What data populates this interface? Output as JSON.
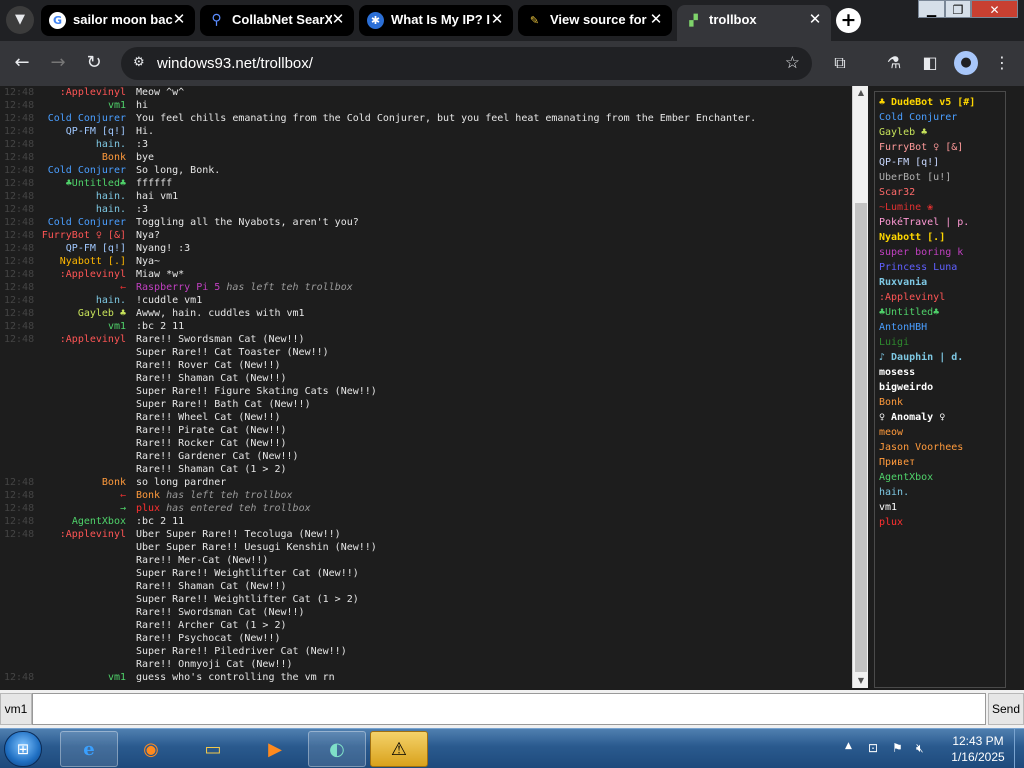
{
  "browser": {
    "tabs": [
      {
        "title": "sailor moon bac",
        "icon": "google-g",
        "active": false
      },
      {
        "title": "CollabNet SearX",
        "icon": "magnifier",
        "active": false
      },
      {
        "title": "What Is My IP? I",
        "icon": "ip-globe",
        "active": false
      },
      {
        "title": "View source for",
        "icon": "wiki",
        "active": false
      },
      {
        "title": "trollbox",
        "icon": "windows93",
        "active": true
      }
    ],
    "url": "windows93.net/trollbox/"
  },
  "chat": {
    "messages": [
      {
        "time": "12:48",
        "nick": ":Applevinyl",
        "nick_color": "#ff5555",
        "text": "Meow ^w^",
        "type": "msg"
      },
      {
        "time": "12:48",
        "nick": "vm1",
        "nick_color": "#4fd26a",
        "text": "hi",
        "type": "msg"
      },
      {
        "time": "12:48",
        "nick": "Cold Conjurer",
        "nick_color": "#4a9eff",
        "text": "You feel chills emanating from the Cold Conjurer, but you feel heat emanating from the Ember Enchanter.",
        "type": "msg"
      },
      {
        "time": "12:48",
        "nick": "QP-FM [q!]",
        "nick_color": "#a0c8ff",
        "text": "Hi.",
        "type": "msg"
      },
      {
        "time": "12:48",
        "nick": "hain.",
        "nick_color": "#7ec8e3",
        "text": ":3",
        "type": "msg"
      },
      {
        "time": "12:48",
        "nick": "Bonk",
        "nick_color": "#ff9a3c",
        "text": "bye",
        "type": "msg"
      },
      {
        "time": "12:48",
        "nick": "Cold Conjurer",
        "nick_color": "#4a9eff",
        "text": "So long, Bonk.",
        "type": "msg"
      },
      {
        "time": "12:48",
        "nick": "♣Untitled♣",
        "nick_color": "#4fd26a",
        "text": "ffffff",
        "type": "msg"
      },
      {
        "time": "12:48",
        "nick": "hain.",
        "nick_color": "#7ec8e3",
        "text": "hai vm1",
        "type": "msg"
      },
      {
        "time": "12:48",
        "nick": "hain.",
        "nick_color": "#7ec8e3",
        "text": ":3",
        "type": "msg"
      },
      {
        "time": "12:48",
        "nick": "Cold Conjurer",
        "nick_color": "#4a9eff",
        "text": "Toggling all the Nyabots, aren't you?",
        "type": "msg"
      },
      {
        "time": "12:48",
        "nick": "FurryBot ♀ [&]",
        "nick_color": "#ff5555",
        "text": "Nya?",
        "type": "msg"
      },
      {
        "time": "12:48",
        "nick": "QP-FM [q!]",
        "nick_color": "#a0c8ff",
        "text": "Nyang! :3",
        "type": "msg"
      },
      {
        "time": "12:48",
        "nick": "Nyabott [.]",
        "nick_color": "#ffb800",
        "text": "Nya~",
        "type": "msg"
      },
      {
        "time": "12:48",
        "nick": ":Applevinyl",
        "nick_color": "#ff5555",
        "text": "Miaw *w*",
        "type": "msg"
      },
      {
        "time": "12:48",
        "nick": "←",
        "nick_color": "#e03030",
        "sys_name": "Raspberry Pi 5",
        "sys_color": "#c040c0",
        "text": "has left teh trollbox",
        "type": "sys"
      },
      {
        "time": "12:48",
        "nick": "hain.",
        "nick_color": "#7ec8e3",
        "text": "!cuddle vm1",
        "type": "msg"
      },
      {
        "time": "12:48",
        "nick": "Gayleb ♣",
        "nick_color": "#c8e35a",
        "text": "Awww, hain. cuddles with vm1",
        "type": "msg"
      },
      {
        "time": "12:48",
        "nick": "vm1",
        "nick_color": "#4fd26a",
        "text": ":bc 2 11",
        "type": "msg"
      },
      {
        "time": "12:48",
        "nick": ":Applevinyl",
        "nick_color": "#ff5555",
        "text": "Rare!! Swordsman Cat (New!!)",
        "type": "msg"
      },
      {
        "time": "",
        "nick": "",
        "nick_color": "#ffffff",
        "text": "Super Rare!! Cat Toaster (New!!)",
        "type": "cont"
      },
      {
        "time": "",
        "nick": "",
        "nick_color": "#ffffff",
        "text": "Rare!! Rover Cat (New!!)",
        "type": "cont"
      },
      {
        "time": "",
        "nick": "",
        "nick_color": "#ffffff",
        "text": "Rare!! Shaman Cat (New!!)",
        "type": "cont"
      },
      {
        "time": "",
        "nick": "",
        "nick_color": "#ffffff",
        "text": "Super Rare!! Figure Skating Cats (New!!)",
        "type": "cont"
      },
      {
        "time": "",
        "nick": "",
        "nick_color": "#ffffff",
        "text": "Super Rare!! Bath Cat (New!!)",
        "type": "cont"
      },
      {
        "time": "",
        "nick": "",
        "nick_color": "#ffffff",
        "text": "Rare!! Wheel Cat (New!!)",
        "type": "cont"
      },
      {
        "time": "",
        "nick": "",
        "nick_color": "#ffffff",
        "text": "Rare!! Pirate Cat (New!!)",
        "type": "cont"
      },
      {
        "time": "",
        "nick": "",
        "nick_color": "#ffffff",
        "text": "Rare!! Rocker Cat (New!!)",
        "type": "cont"
      },
      {
        "time": "",
        "nick": "",
        "nick_color": "#ffffff",
        "text": "Rare!! Gardener Cat (New!!)",
        "type": "cont"
      },
      {
        "time": "",
        "nick": "",
        "nick_color": "#ffffff",
        "text": "Rare!! Shaman Cat (1 > 2)",
        "type": "cont"
      },
      {
        "time": "12:48",
        "nick": "Bonk",
        "nick_color": "#ff9a3c",
        "text": "so long pardner",
        "type": "msg"
      },
      {
        "time": "12:48",
        "nick": "←",
        "nick_color": "#e03030",
        "sys_name": "Bonk",
        "sys_color": "#ff9a3c",
        "text": "has left teh trollbox",
        "type": "sys"
      },
      {
        "time": "12:48",
        "nick": "→",
        "nick_color": "#4fd26a",
        "sys_name": "plux",
        "sys_color": "#ff3030",
        "text": "has entered teh trollbox",
        "type": "sys"
      },
      {
        "time": "12:48",
        "nick": "AgentXbox",
        "nick_color": "#4fd26a",
        "text": ":bc 2 11",
        "type": "msg"
      },
      {
        "time": "12:48",
        "nick": ":Applevinyl",
        "nick_color": "#ff5555",
        "text": "Uber Super Rare!! Tecoluga (New!!)",
        "type": "msg"
      },
      {
        "time": "",
        "nick": "",
        "nick_color": "#ffffff",
        "text": "Uber Super Rare!! Uesugi Kenshin (New!!)",
        "type": "cont"
      },
      {
        "time": "",
        "nick": "",
        "nick_color": "#ffffff",
        "text": "Rare!! Mer-Cat (New!!)",
        "type": "cont"
      },
      {
        "time": "",
        "nick": "",
        "nick_color": "#ffffff",
        "text": "Super Rare!! Weightlifter Cat (New!!)",
        "type": "cont"
      },
      {
        "time": "",
        "nick": "",
        "nick_color": "#ffffff",
        "text": "Rare!! Shaman Cat (New!!)",
        "type": "cont"
      },
      {
        "time": "",
        "nick": "",
        "nick_color": "#ffffff",
        "text": "Super Rare!! Weightlifter Cat (1 > 2)",
        "type": "cont"
      },
      {
        "time": "",
        "nick": "",
        "nick_color": "#ffffff",
        "text": "Rare!! Swordsman Cat (New!!)",
        "type": "cont"
      },
      {
        "time": "",
        "nick": "",
        "nick_color": "#ffffff",
        "text": "Rare!! Archer Cat (1 > 2)",
        "type": "cont"
      },
      {
        "time": "",
        "nick": "",
        "nick_color": "#ffffff",
        "text": "Rare!! Psychocat (New!!)",
        "type": "cont"
      },
      {
        "time": "",
        "nick": "",
        "nick_color": "#ffffff",
        "text": "Super Rare!! Piledriver Cat (New!!)",
        "type": "cont"
      },
      {
        "time": "",
        "nick": "",
        "nick_color": "#ffffff",
        "text": "Rare!! Onmyoji Cat (New!!)",
        "type": "cont"
      },
      {
        "time": "12:48",
        "nick": "vm1",
        "nick_color": "#4fd26a",
        "text": "guess who's controlling the vm rn",
        "type": "msg"
      }
    ]
  },
  "users": [
    {
      "name": "♣ DudeBot v5 [#]",
      "color": "#ffd700",
      "bold": true
    },
    {
      "name": "Cold Conjurer",
      "color": "#4a9eff",
      "bold": false
    },
    {
      "name": "Gayleb ♣",
      "color": "#c8e35a",
      "bold": false
    },
    {
      "name": "FurryBot ♀ [&]",
      "color": "#ff9a9a",
      "bold": false
    },
    {
      "name": "QP-FM [q!]",
      "color": "#c8d8ff",
      "bold": false
    },
    {
      "name": "UberBot [u!]",
      "color": "#b0b0b0",
      "bold": false
    },
    {
      "name": "Scar32",
      "color": "#ff6a6a",
      "bold": false
    },
    {
      "name": "~Lumine ❀",
      "color": "#e03030",
      "bold": false
    },
    {
      "name": "PokéTravel | p.",
      "color": "#ff9ad5",
      "bold": false
    },
    {
      "name": "Nyabott [.]",
      "color": "#ffd700",
      "bold": true
    },
    {
      "name": "super boring k",
      "color": "#c040c0",
      "bold": false
    },
    {
      "name": "Princess Luna",
      "color": "#6060ff",
      "bold": false
    },
    {
      "name": "Ruxvania",
      "color": "#7ec8e3",
      "bold": true
    },
    {
      "name": ":Applevinyl",
      "color": "#ff5555",
      "bold": false
    },
    {
      "name": "♣Untitled♣",
      "color": "#4fd26a",
      "bold": false
    },
    {
      "name": "AntonHBH",
      "color": "#4a9eff",
      "bold": false
    },
    {
      "name": "Luigi",
      "color": "#2e8b2e",
      "bold": false
    },
    {
      "name": "♪ Dauphin | d.",
      "color": "#7ec8e3",
      "bold": true
    },
    {
      "name": "mosess",
      "color": "#ffffff",
      "bold": true
    },
    {
      "name": "bigweirdo",
      "color": "#ffffff",
      "bold": true
    },
    {
      "name": "Bonk",
      "color": "#ff9a3c",
      "bold": false
    },
    {
      "name": "♀ Anomaly ♀",
      "color": "#ffffff",
      "bold": true
    },
    {
      "name": "meow",
      "color": "#ff9a3c",
      "bold": false
    },
    {
      "name": "Jason Voorhees",
      "color": "#ff9a3c",
      "bold": false
    },
    {
      "name": "Привет",
      "color": "#ff9a3c",
      "bold": false
    },
    {
      "name": "AgentXbox",
      "color": "#4fd26a",
      "bold": false
    },
    {
      "name": "hain.",
      "color": "#7ec8e3",
      "bold": false
    },
    {
      "name": "vm1",
      "color": "#ffffff",
      "bold": false
    },
    {
      "name": "plux",
      "color": "#ff3030",
      "bold": false
    }
  ],
  "input": {
    "nick_label": "vm1",
    "value": "",
    "placeholder": "",
    "send_label": "Send"
  },
  "taskbar": {
    "time": "12:43 PM",
    "date": "1/16/2025"
  }
}
